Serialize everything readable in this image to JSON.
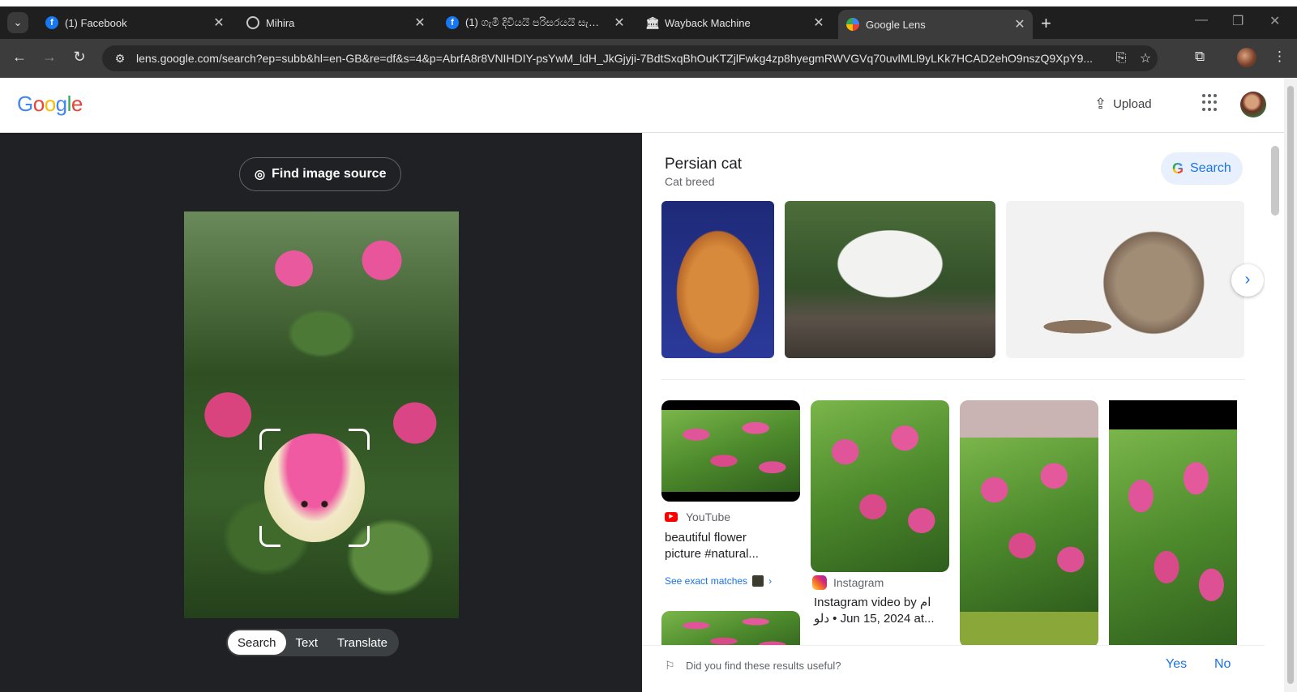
{
  "browser": {
    "tabs": [
      {
        "title": "(1) Facebook",
        "icon": "facebook-icon"
      },
      {
        "title": "Mihira",
        "icon": "globe-icon"
      },
      {
        "title": "(1) ගැමි දිවියයි පරිසරයයි සැ…",
        "icon": "facebook-icon"
      },
      {
        "title": "Wayback Machine",
        "icon": "archive-icon"
      },
      {
        "title": "Google Lens",
        "icon": "google-lens-icon",
        "active": true
      }
    ],
    "url": "lens.google.com/search?ep=subb&hl=en-GB&re=df&s=4&p=AbrfA8r8VNIHDIY-psYwM_ldH_JkGjyji-7BdtSxqBhOuKTZjlFwkg4zp8hyegmRWVGVq70uvlMLl9yLKk7HCAD2ehO9nszQ9XpY9..."
  },
  "header": {
    "logo": "Google",
    "upload_label": "Upload"
  },
  "left": {
    "find_source_label": "Find image source",
    "modes": [
      "Search",
      "Text",
      "Translate"
    ],
    "active_mode": "Search"
  },
  "right": {
    "entity_title": "Persian cat",
    "entity_subtitle": "Cat breed",
    "search_label": "Search",
    "results": [
      {
        "source": "YouTube",
        "title_line1": "beautiful flower",
        "title_line2": "picture #natural...",
        "exact_matches": "See exact matches"
      },
      {
        "source": "Instagram",
        "title_line1": "Instagram video by ام",
        "title_line2": "دلو • Jun 15, 2024 at..."
      }
    ],
    "feedback_question": "Did you find these results useful?",
    "feedback_yes": "Yes",
    "feedback_no": "No"
  },
  "colors": {
    "accent": "#1a73e8",
    "dark_pane": "#202124",
    "chrome_dark": "#1f1f1f"
  }
}
